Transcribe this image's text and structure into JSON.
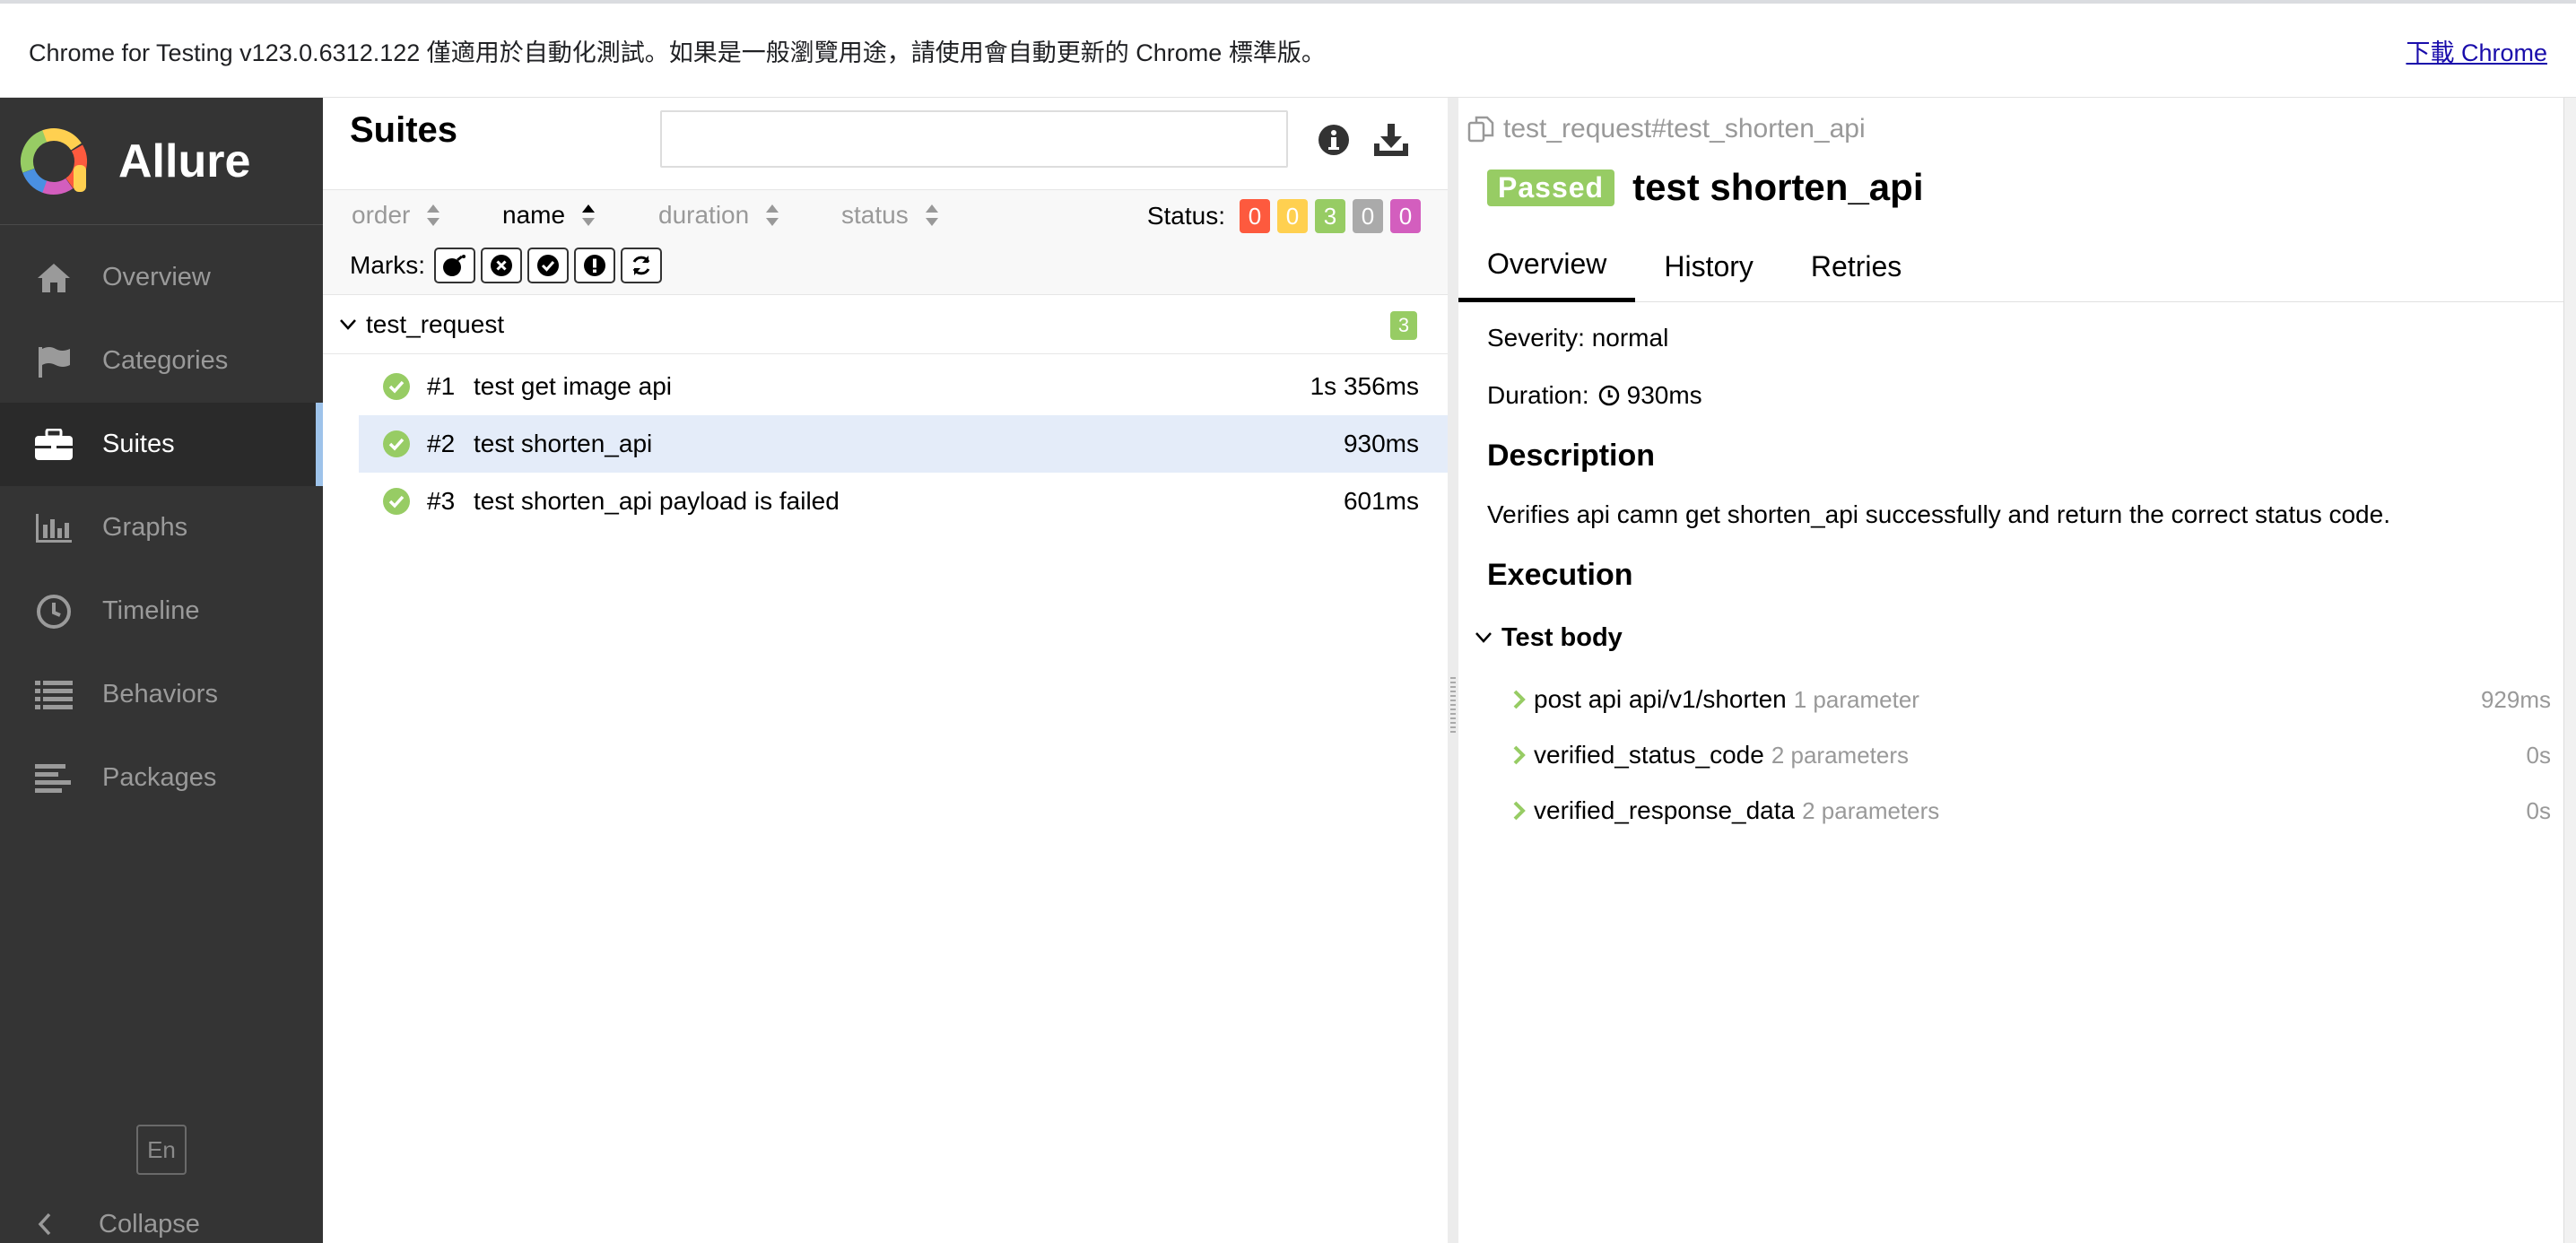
{
  "infobar": {
    "message": "Chrome for Testing v123.0.6312.122 僅適用於自動化測試。如果是一般瀏覽用途，請使用會自動更新的 Chrome 標準版。",
    "link": "下載 Chrome"
  },
  "sidebar": {
    "brand": "Allure",
    "items": [
      {
        "label": "Overview",
        "icon": "home-icon"
      },
      {
        "label": "Categories",
        "icon": "flag-icon"
      },
      {
        "label": "Suites",
        "icon": "briefcase-icon",
        "active": true
      },
      {
        "label": "Graphs",
        "icon": "bar-chart-icon"
      },
      {
        "label": "Timeline",
        "icon": "clock-icon"
      },
      {
        "label": "Behaviors",
        "icon": "list-icon"
      },
      {
        "label": "Packages",
        "icon": "align-left-icon"
      }
    ],
    "language": "En",
    "collapse": "Collapse"
  },
  "suites": {
    "title": "Suites",
    "search": {
      "value": "",
      "placeholder": ""
    },
    "sort": {
      "order": "order",
      "name": "name",
      "duration": "duration",
      "status": "status"
    },
    "status_filter": {
      "label": "Status:",
      "counts": [
        {
          "value": "0",
          "color": "#fd5a3e"
        },
        {
          "value": "0",
          "color": "#ffd050"
        },
        {
          "value": "3",
          "color": "#97cc64"
        },
        {
          "value": "0",
          "color": "#aaaaaa"
        },
        {
          "value": "0",
          "color": "#d35ebe"
        }
      ]
    },
    "marks_label": "Marks:",
    "group": {
      "name": "test_request",
      "count": "3"
    },
    "tests": [
      {
        "num": "#1",
        "name": "test get image api",
        "duration": "1s 356ms"
      },
      {
        "num": "#2",
        "name": "test shorten_api",
        "duration": "930ms",
        "selected": true
      },
      {
        "num": "#3",
        "name": "test shorten_api payload is failed",
        "duration": "601ms"
      }
    ]
  },
  "result": {
    "path": "test_request#test_shorten_api",
    "status": "Passed",
    "title": "test shorten_api",
    "tabs": [
      "Overview",
      "History",
      "Retries"
    ],
    "severity": "Severity: normal",
    "duration_label": "Duration:",
    "duration": "930ms",
    "description_title": "Description",
    "description": "Verifies api camn get shorten_api successfully and return the correct status code.",
    "execution_title": "Execution",
    "test_body": "Test body",
    "steps": [
      {
        "name": "post api api/v1/shorten",
        "params": "1 parameter",
        "duration": "929ms"
      },
      {
        "name": "verified_status_code",
        "params": "2 parameters",
        "duration": "0s"
      },
      {
        "name": "verified_response_data",
        "params": "2 parameters",
        "duration": "0s"
      }
    ]
  },
  "colors": {
    "sidebar_bg": "#343434",
    "passed": "#97cc64",
    "selected_row": "#e4ecf9",
    "active_indicator": "#9ec3ea"
  }
}
